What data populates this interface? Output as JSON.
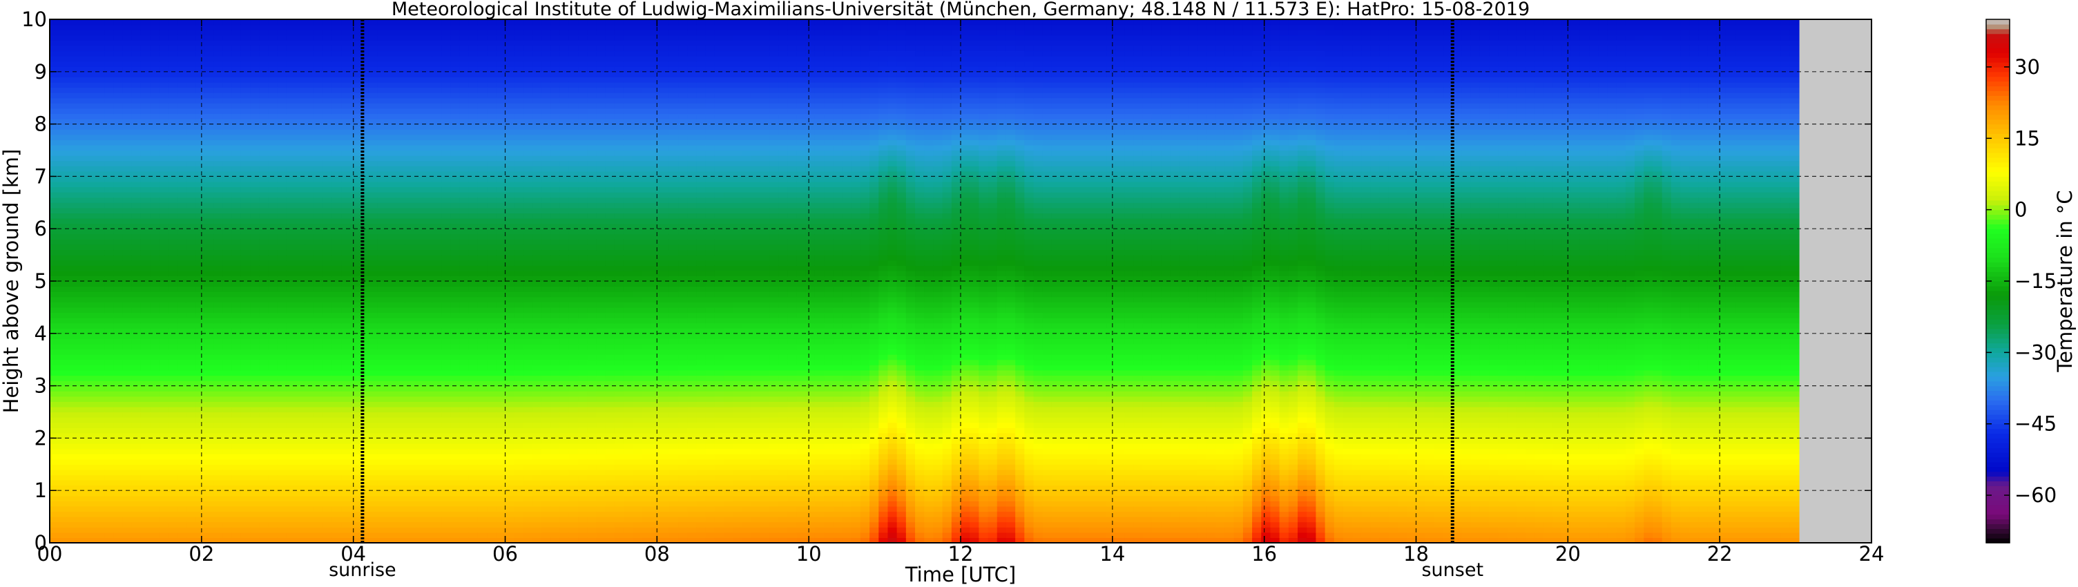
{
  "chart_data": {
    "type": "heatmap",
    "title": "Meteorological Institute of Ludwig-Maximilians-Universität (München, Germany; 48.148 N / 11.573 E):     HatPro: 15-08-2019",
    "xlabel": "Time [UTC]",
    "ylabel": "Height above ground [km]",
    "xlim": [
      0,
      24
    ],
    "ylim": [
      0,
      10
    ],
    "x_ticks": [
      0,
      2,
      4,
      6,
      8,
      10,
      12,
      14,
      16,
      18,
      20,
      22,
      24
    ],
    "x_tick_labels": [
      "00",
      "02",
      "04",
      "06",
      "08",
      "10",
      "12",
      "14",
      "16",
      "18",
      "20",
      "22",
      "24"
    ],
    "y_ticks": [
      0,
      1,
      2,
      3,
      4,
      5,
      6,
      7,
      8,
      9,
      10
    ],
    "y_tick_labels": [
      "0",
      "1",
      "2",
      "3",
      "4",
      "5",
      "6",
      "7",
      "8",
      "9",
      "10"
    ],
    "grid": true,
    "data_end_time": 23.05,
    "no_data_color": "#c8c8c8",
    "markers": [
      {
        "label": "sunrise",
        "time": 4.12
      },
      {
        "label": "sunset",
        "time": 18.48
      }
    ],
    "temperature_profile_reference": {
      "height_km": [
        0,
        0.5,
        1,
        1.5,
        2,
        2.5,
        3,
        4,
        5,
        6,
        7,
        8,
        9,
        10
      ],
      "temperature_c": [
        21,
        17,
        13,
        9,
        5.5,
        2,
        -2,
        -10,
        -17,
        -23,
        -31,
        -39,
        -47,
        -53
      ]
    },
    "warm_events": [
      {
        "time": 11.1,
        "surface_temperature_c": 34
      },
      {
        "time": 12.1,
        "surface_temperature_c": 31
      },
      {
        "time": 12.6,
        "surface_temperature_c": 31
      },
      {
        "time": 16.05,
        "surface_temperature_c": 33
      },
      {
        "time": 16.55,
        "surface_temperature_c": 34
      },
      {
        "time": 21.1,
        "surface_temperature_c": 24
      }
    ],
    "colorbar": {
      "label": "Temperature in °C",
      "min": -70,
      "max": 40,
      "ticks": [
        30,
        15,
        0,
        -15,
        -30,
        -45,
        -60
      ],
      "tick_labels": [
        "30",
        "15",
        "0",
        "−15",
        "−30",
        "−45",
        "−60"
      ],
      "color_stops": [
        {
          "t": -70,
          "color": "#000000"
        },
        {
          "t": -67,
          "color": "#3a0a3a"
        },
        {
          "t": -64,
          "color": "#7a0a7a"
        },
        {
          "t": -58,
          "color": "#6a1a8a"
        },
        {
          "t": -55,
          "color": "#0008c8"
        },
        {
          "t": -47,
          "color": "#0a2ae6"
        },
        {
          "t": -40,
          "color": "#2a6ef0"
        },
        {
          "t": -35,
          "color": "#2aa0e0"
        },
        {
          "t": -30,
          "color": "#10a8a0"
        },
        {
          "t": -24,
          "color": "#0aa040"
        },
        {
          "t": -18,
          "color": "#0a9a0a"
        },
        {
          "t": -10,
          "color": "#1ce01c"
        },
        {
          "t": -4,
          "color": "#20ff20"
        },
        {
          "t": 2,
          "color": "#c8f00a"
        },
        {
          "t": 8,
          "color": "#ffff00"
        },
        {
          "t": 15,
          "color": "#ffc800"
        },
        {
          "t": 22,
          "color": "#ff8c00"
        },
        {
          "t": 28,
          "color": "#ff3a00"
        },
        {
          "t": 33,
          "color": "#e00000"
        },
        {
          "t": 37,
          "color": "#c81010"
        },
        {
          "t": 38,
          "color": "#b08060"
        },
        {
          "t": 40,
          "color": "#c8c8c8"
        }
      ]
    }
  }
}
